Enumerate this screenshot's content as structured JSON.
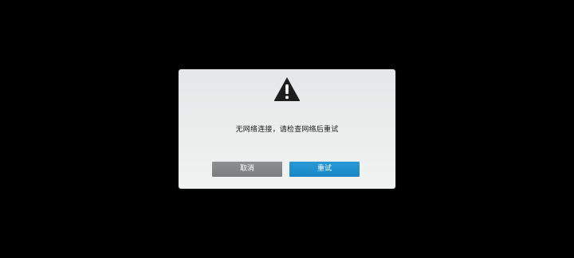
{
  "dialog": {
    "icon": "warning-triangle-icon",
    "message": "无网络连接，请检查网络后重试",
    "cancel_label": "取消",
    "retry_label": "重试"
  },
  "colors": {
    "background": "#000000",
    "dialog_bg": "#eceeee",
    "cancel_button": "#858687",
    "retry_button": "#1f90cf",
    "icon": "#1e1e1e"
  }
}
